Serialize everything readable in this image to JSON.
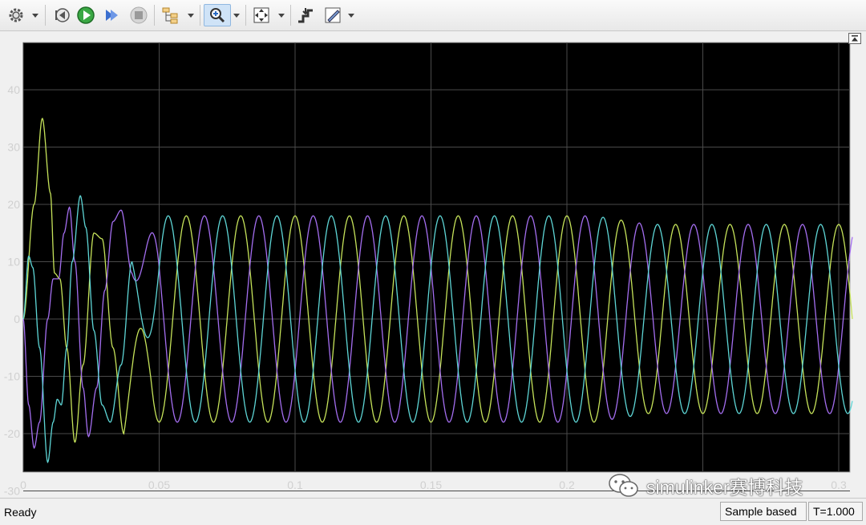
{
  "toolbar": {
    "buttons": [
      {
        "name": "settings-icon"
      },
      {
        "name": "step-back-icon"
      },
      {
        "name": "run-icon"
      },
      {
        "name": "step-forward-icon"
      },
      {
        "name": "stop-icon"
      },
      {
        "name": "signal-hierarchy-icon"
      },
      {
        "name": "zoom-icon",
        "active": true
      },
      {
        "name": "fit-to-view-icon"
      },
      {
        "name": "cursor-measurements-icon"
      },
      {
        "name": "style-icon"
      }
    ]
  },
  "status": {
    "text": "Ready",
    "sample_mode": "Sample based",
    "time": "T=1.000"
  },
  "watermark": {
    "text": "simulinker赛博科技"
  },
  "chart_data": {
    "type": "line",
    "title": "",
    "xlabel": "",
    "ylabel": "",
    "xlim": [
      0,
      0.305
    ],
    "ylim": [
      -32,
      43
    ],
    "x_ticks": [
      "0",
      "0.05",
      "0.1",
      "0.15",
      "0.2",
      "0.25",
      "0.3"
    ],
    "y_ticks": [
      "40",
      "30",
      "20",
      "10",
      "0",
      "-10",
      "-20",
      "-30"
    ],
    "grid": true,
    "background": "#000000",
    "series": [
      {
        "color": "#c6e35a",
        "frequency_hz": 50,
        "phase_deg": 90,
        "steady_amplitude": 18,
        "amplitude_after_t": {
          "t": 0.21,
          "amplitude": 16.5
        },
        "transient_points": [
          [
            0,
            0
          ],
          [
            0.004,
            20
          ],
          [
            0.007,
            35
          ],
          [
            0.01,
            22
          ],
          [
            0.0115,
            8
          ],
          [
            0.0135,
            7
          ],
          [
            0.016,
            -5
          ],
          [
            0.019,
            -21.5
          ],
          [
            0.022,
            -8
          ],
          [
            0.026,
            15
          ],
          [
            0.029,
            14
          ],
          [
            0.033,
            -5
          ],
          [
            0.037,
            -20
          ]
        ]
      },
      {
        "color": "#a46ef0",
        "frequency_hz": 50,
        "phase_deg": -30,
        "steady_amplitude": 18,
        "amplitude_after_t": {
          "t": 0.21,
          "amplitude": 16.5
        },
        "transient_points": [
          [
            0,
            0
          ],
          [
            0.002,
            -15
          ],
          [
            0.004,
            -22.5
          ],
          [
            0.006,
            -18
          ],
          [
            0.009,
            0
          ],
          [
            0.011,
            7
          ],
          [
            0.013,
            7
          ],
          [
            0.015,
            15
          ],
          [
            0.017,
            19.5
          ],
          [
            0.019,
            10
          ],
          [
            0.022,
            -12
          ],
          [
            0.024,
            -20.5
          ],
          [
            0.027,
            -12
          ],
          [
            0.03,
            5
          ],
          [
            0.033,
            17
          ],
          [
            0.036,
            19
          ],
          [
            0.04,
            8
          ]
        ]
      },
      {
        "color": "#5ed6d6",
        "frequency_hz": 50,
        "phase_deg": 210,
        "steady_amplitude": 18,
        "amplitude_after_t": {
          "t": 0.21,
          "amplitude": 16.5
        },
        "transient_points": [
          [
            0,
            0
          ],
          [
            0.002,
            11
          ],
          [
            0.0035,
            9
          ],
          [
            0.006,
            -5
          ],
          [
            0.009,
            -25
          ],
          [
            0.011,
            -18
          ],
          [
            0.0125,
            -14
          ],
          [
            0.014,
            -15
          ],
          [
            0.016,
            -5
          ],
          [
            0.018,
            10
          ],
          [
            0.021,
            21.5
          ],
          [
            0.023,
            16
          ],
          [
            0.026,
            -2
          ],
          [
            0.029,
            -15
          ],
          [
            0.032,
            -18
          ],
          [
            0.036,
            -8
          ],
          [
            0.04,
            10
          ]
        ]
      }
    ]
  }
}
